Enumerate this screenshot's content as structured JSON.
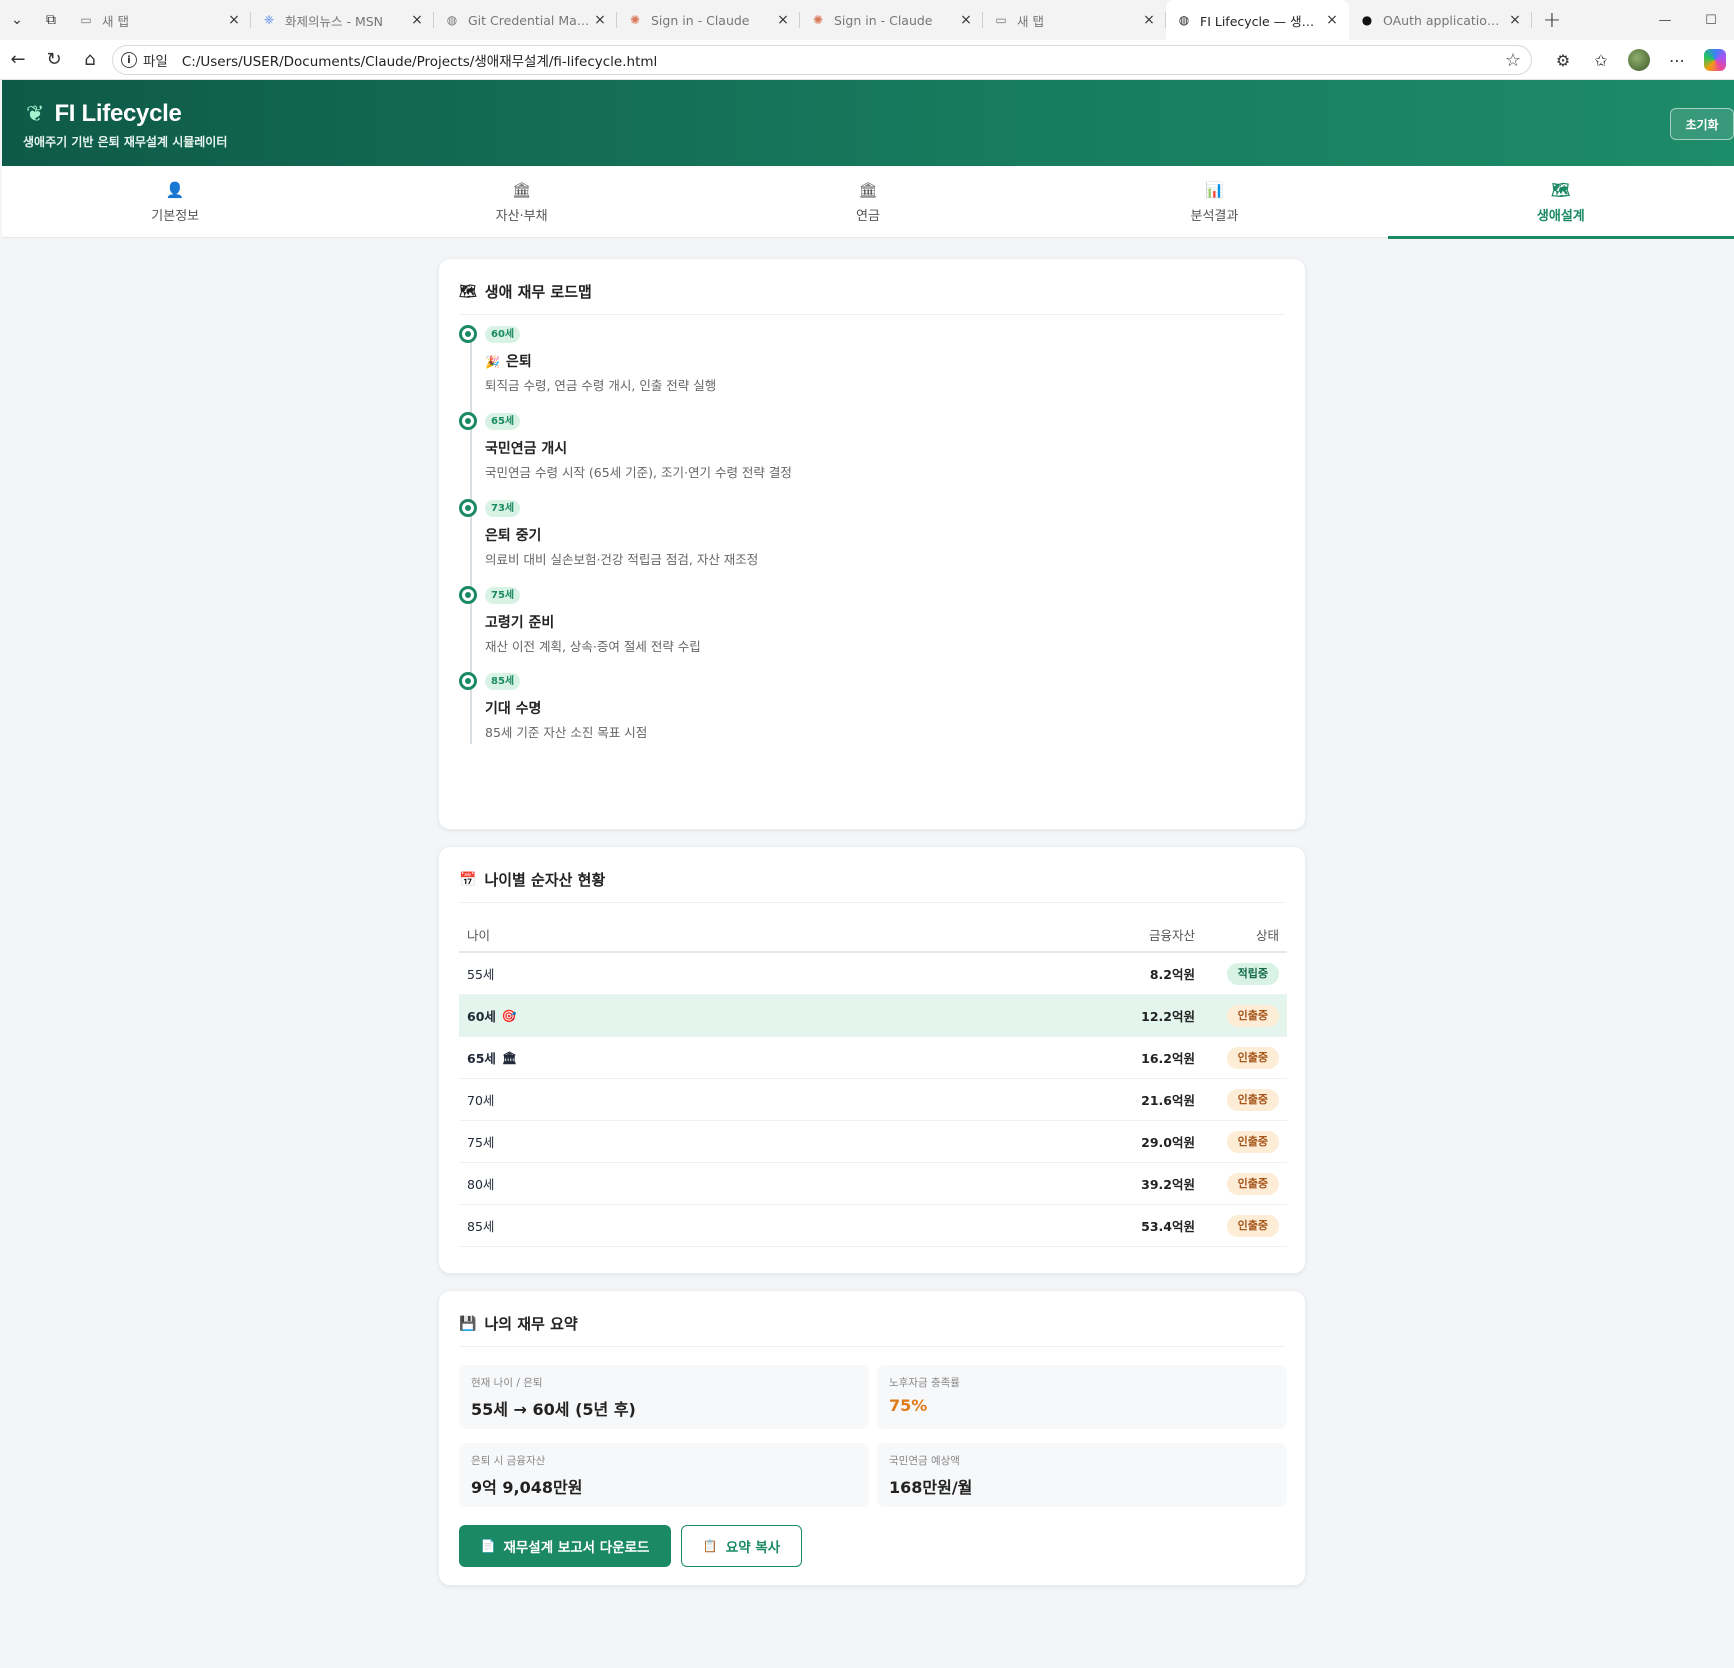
{
  "browser": {
    "tabs": [
      {
        "title": "새 탭",
        "icon": "new-tab-icon"
      },
      {
        "title": "화제의뉴스 - MSN",
        "icon": "msn-butterfly-icon"
      },
      {
        "title": "Git Credential Manager",
        "icon": "globe-icon"
      },
      {
        "title": "Sign in - Claude",
        "icon": "claude-sunburst-icon"
      },
      {
        "title": "Sign in - Claude",
        "icon": "claude-sunburst-icon"
      },
      {
        "title": "새 탭",
        "icon": "new-tab-icon"
      },
      {
        "title": "FI Lifecycle — 생애주기",
        "icon": "globe-icon",
        "active": true
      },
      {
        "title": "OAuth application auth",
        "icon": "github-icon"
      }
    ],
    "address": {
      "scheme_label": "파일",
      "url": "C:/Users/USER/Documents/Claude/Projects/생애재무설계/fi-lifecycle.html"
    }
  },
  "app": {
    "brand": "FI Lifecycle",
    "tagline": "생애주기 기반 은퇴 재무설계 시뮬레이터",
    "reset_label": "초기화"
  },
  "nav": {
    "tabs": [
      {
        "label": "기본정보",
        "icon": "person-icon"
      },
      {
        "label": "자산·부채",
        "icon": "bank-icon"
      },
      {
        "label": "연금",
        "icon": "bank-icon"
      },
      {
        "label": "분석결과",
        "icon": "bar-chart-icon"
      },
      {
        "label": "생애설계",
        "icon": "map-icon",
        "active": true
      }
    ]
  },
  "roadmap": {
    "title": "생애 재무 로드맵",
    "milestones": [
      {
        "age": "60세",
        "emoji": "🎉",
        "title": "은퇴",
        "desc": "퇴직금 수령, 연금 수령 개시, 인출 전략 실행"
      },
      {
        "age": "65세",
        "emoji": "",
        "title": "국민연금 개시",
        "desc": "국민연금 수령 시작 (65세 기준), 조기·연기 수령 전략 결정"
      },
      {
        "age": "73세",
        "emoji": "",
        "title": "은퇴 중기",
        "desc": "의료비 대비 실손보험·건강 적립금 점검, 자산 재조정"
      },
      {
        "age": "75세",
        "emoji": "",
        "title": "고령기 준비",
        "desc": "재산 이전 계획, 상속·증여 절세 전략 수립"
      },
      {
        "age": "85세",
        "emoji": "",
        "title": "기대 수명",
        "desc": "85세 기준 자산 소진 목표 시점"
      }
    ]
  },
  "networth": {
    "title": "나이별 순자산 현황",
    "headers": {
      "age": "나이",
      "assets": "금융자산",
      "status": "상태"
    },
    "rows": [
      {
        "age": "55세",
        "assets": "8.2억원",
        "status": "적립중",
        "kind": "save",
        "bold": false,
        "icon": ""
      },
      {
        "age": "60세",
        "assets": "12.2억원",
        "status": "인출중",
        "kind": "draw",
        "bold": true,
        "icon": "🎯",
        "highlight": true
      },
      {
        "age": "65세",
        "assets": "16.2억원",
        "status": "인출중",
        "kind": "draw",
        "bold": true,
        "icon": "🏛"
      },
      {
        "age": "70세",
        "assets": "21.6억원",
        "status": "인출중",
        "kind": "draw",
        "bold": false,
        "icon": ""
      },
      {
        "age": "75세",
        "assets": "29.0억원",
        "status": "인출중",
        "kind": "draw",
        "bold": false,
        "icon": ""
      },
      {
        "age": "80세",
        "assets": "39.2억원",
        "status": "인출중",
        "kind": "draw",
        "bold": false,
        "icon": ""
      },
      {
        "age": "85세",
        "assets": "53.4억원",
        "status": "인출중",
        "kind": "draw",
        "bold": false,
        "icon": ""
      }
    ]
  },
  "summary": {
    "title": "나의 재무 요약",
    "items": [
      {
        "label": "현재 나이 / 은퇴",
        "value": "55세 → 60세 (5년 후)"
      },
      {
        "label": "노후자금 충족률",
        "value": "75%"
      },
      {
        "label": "은퇴 시 금융자산",
        "value": "9억 9,048만원"
      },
      {
        "label": "국민연금 예상액",
        "value": "168만원/월"
      }
    ],
    "download_label": "재무설계 보고서 다운로드",
    "copy_label": "요약 복사"
  },
  "colors": {
    "brand": "#1b8a64",
    "header_start": "#0e5a48",
    "header_end": "#1d8c68",
    "warn": "#e07b1a"
  }
}
